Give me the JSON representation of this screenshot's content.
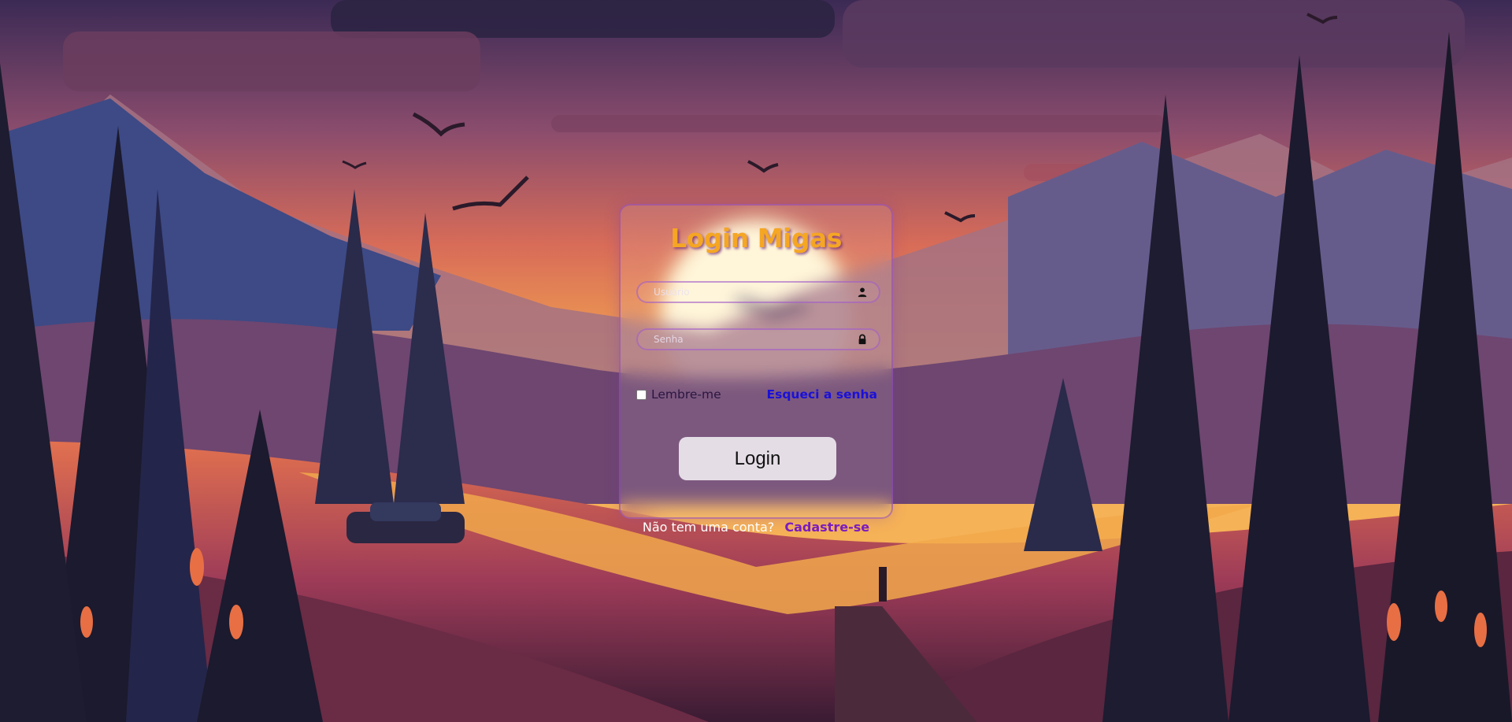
{
  "login": {
    "title": "Login Migas",
    "username_placeholder": "Usuário",
    "password_placeholder": "Senha",
    "remember_label": "Lembre-me",
    "forgot_label": "Esqueci a senha",
    "login_button": "Login",
    "no_account_text": "Não tem uma conta?",
    "signup_link": "Cadastre-se"
  },
  "icons": {
    "username": "user-icon",
    "password": "lock-icon"
  },
  "colors": {
    "title": "#f5a623",
    "forgot_link": "#1a10d8",
    "signup_link": "#7a1cc0",
    "button_bg": "#e4dde6",
    "card_border": "#8c46be"
  }
}
